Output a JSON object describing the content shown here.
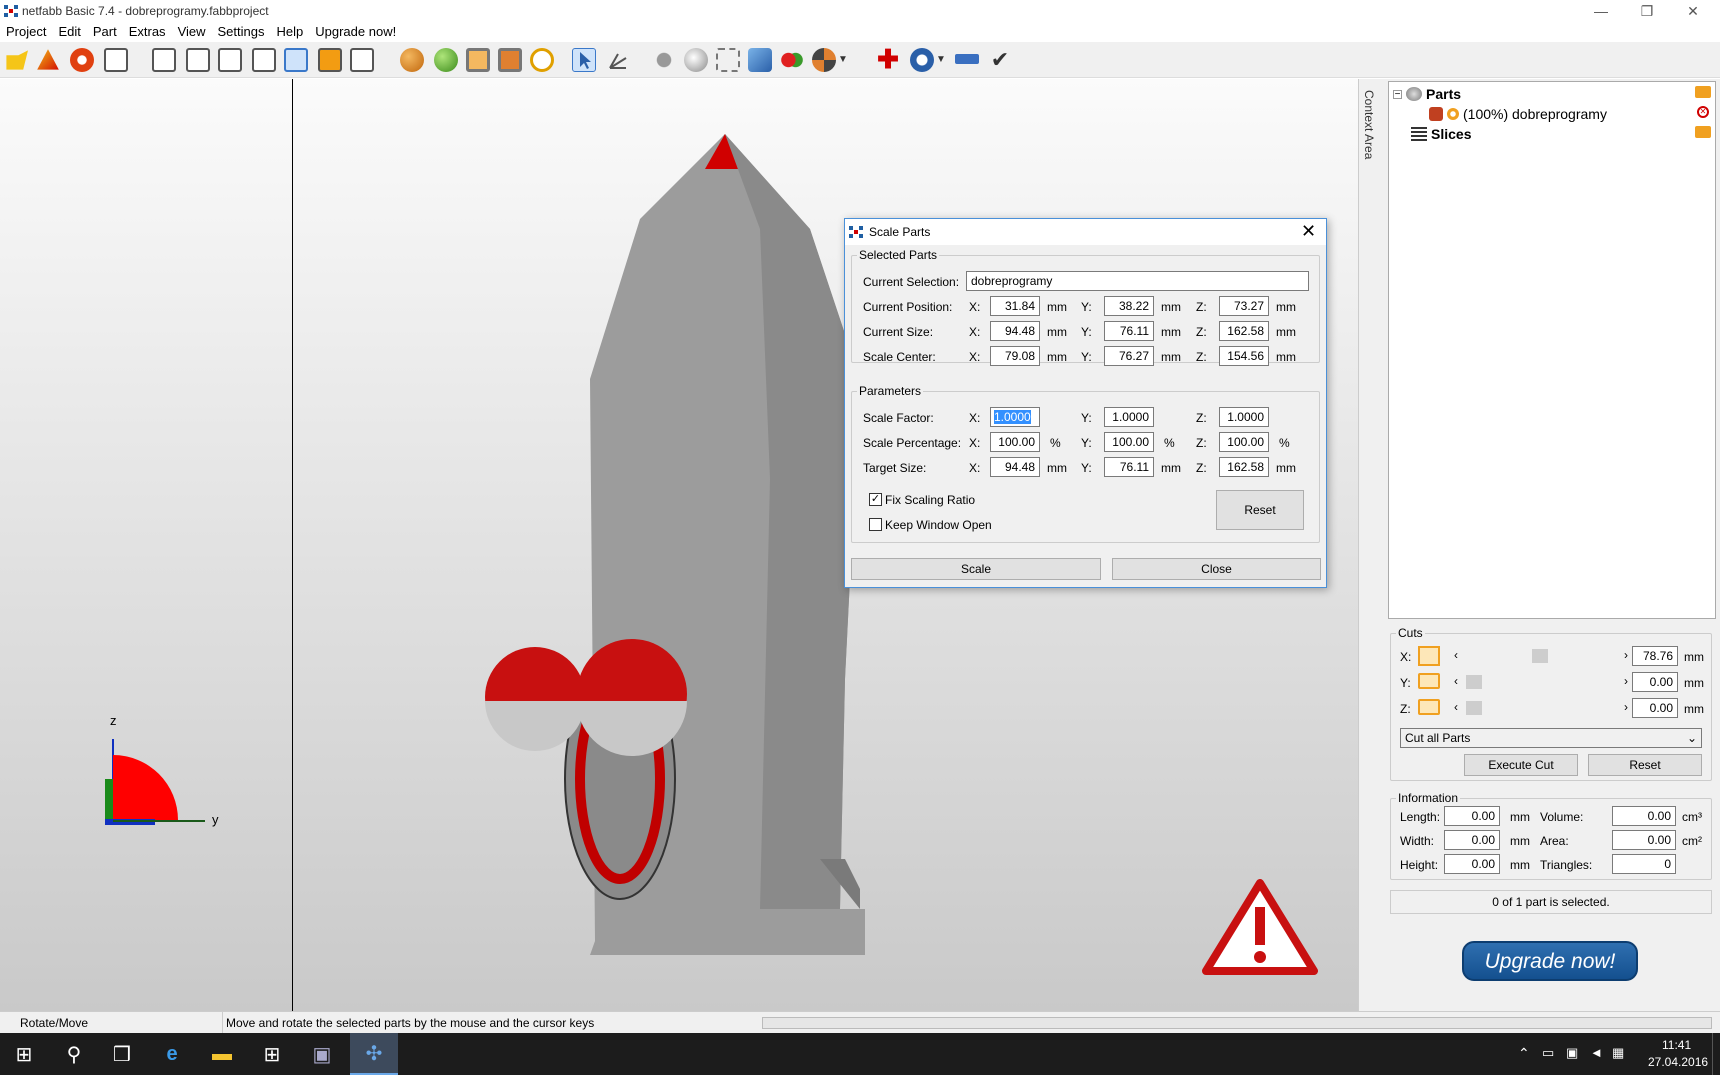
{
  "window": {
    "title": "netfabb Basic 7.4 - dobreprogramy.fabbproject"
  },
  "menu": [
    "Project",
    "Edit",
    "Part",
    "Extras",
    "View",
    "Settings",
    "Help",
    "Upgrade now!"
  ],
  "context_label": "Context Area",
  "tree": {
    "parts": "Parts",
    "part_item": "(100%) dobreprogramy",
    "slices": "Slices"
  },
  "axes": {
    "z": "z",
    "y": "y"
  },
  "dialog": {
    "title": "Scale Parts",
    "selected_parts": "Selected Parts",
    "current_selection_label": "Current Selection:",
    "current_selection": "dobreprogramy",
    "rows": [
      {
        "label": "Current Position:",
        "x": "31.84",
        "y": "38.22",
        "z": "73.27",
        "unit": "mm"
      },
      {
        "label": "Current Size:",
        "x": "94.48",
        "y": "76.11",
        "z": "162.58",
        "unit": "mm"
      },
      {
        "label": "Scale Center:",
        "x": "79.08",
        "y": "76.27",
        "z": "154.56",
        "unit": "mm"
      }
    ],
    "parameters": "Parameters",
    "params": [
      {
        "label": "Scale Factor:",
        "x": "1.0000",
        "y": "1.0000",
        "z": "1.0000",
        "unit": ""
      },
      {
        "label": "Scale Percentage:",
        "x": "100.00",
        "y": "100.00",
        "z": "100.00",
        "unit": "%"
      },
      {
        "label": "Target Size:",
        "x": "94.48",
        "y": "76.11",
        "z": "162.58",
        "unit": "mm"
      }
    ],
    "ax": {
      "x": "X:",
      "y": "Y:",
      "z": "Z:"
    },
    "fix_ratio": "Fix Scaling Ratio",
    "keep_open": "Keep Window Open",
    "reset": "Reset",
    "scale": "Scale",
    "close": "Close"
  },
  "cuts": {
    "title": "Cuts",
    "x_label": "X:",
    "y_label": "Y:",
    "z_label": "Z:",
    "x": "78.76",
    "y": "0.00",
    "z": "0.00",
    "unit": "mm",
    "mode": "Cut all Parts",
    "execute": "Execute Cut",
    "reset": "Reset"
  },
  "info": {
    "title": "Information",
    "length_label": "Length:",
    "width_label": "Width:",
    "height_label": "Height:",
    "length": "0.00",
    "width": "0.00",
    "height": "0.00",
    "mm": "mm",
    "volume_label": "Volume:",
    "area_label": "Area:",
    "triangles_label": "Triangles:",
    "volume": "0.00",
    "area": "0.00",
    "triangles": "0",
    "cm3": "cm³",
    "cm2": "cm²",
    "selection": "0 of 1 part is selected."
  },
  "upgrade": "Upgrade now!",
  "status": {
    "mode": "Rotate/Move",
    "hint": "Move and rotate the selected parts by the mouse and the cursor keys"
  },
  "clock": {
    "time": "11:41",
    "date": "27.04.2016"
  },
  "colors": {
    "accent": "#d00000",
    "brand": "#1f5fa3"
  }
}
